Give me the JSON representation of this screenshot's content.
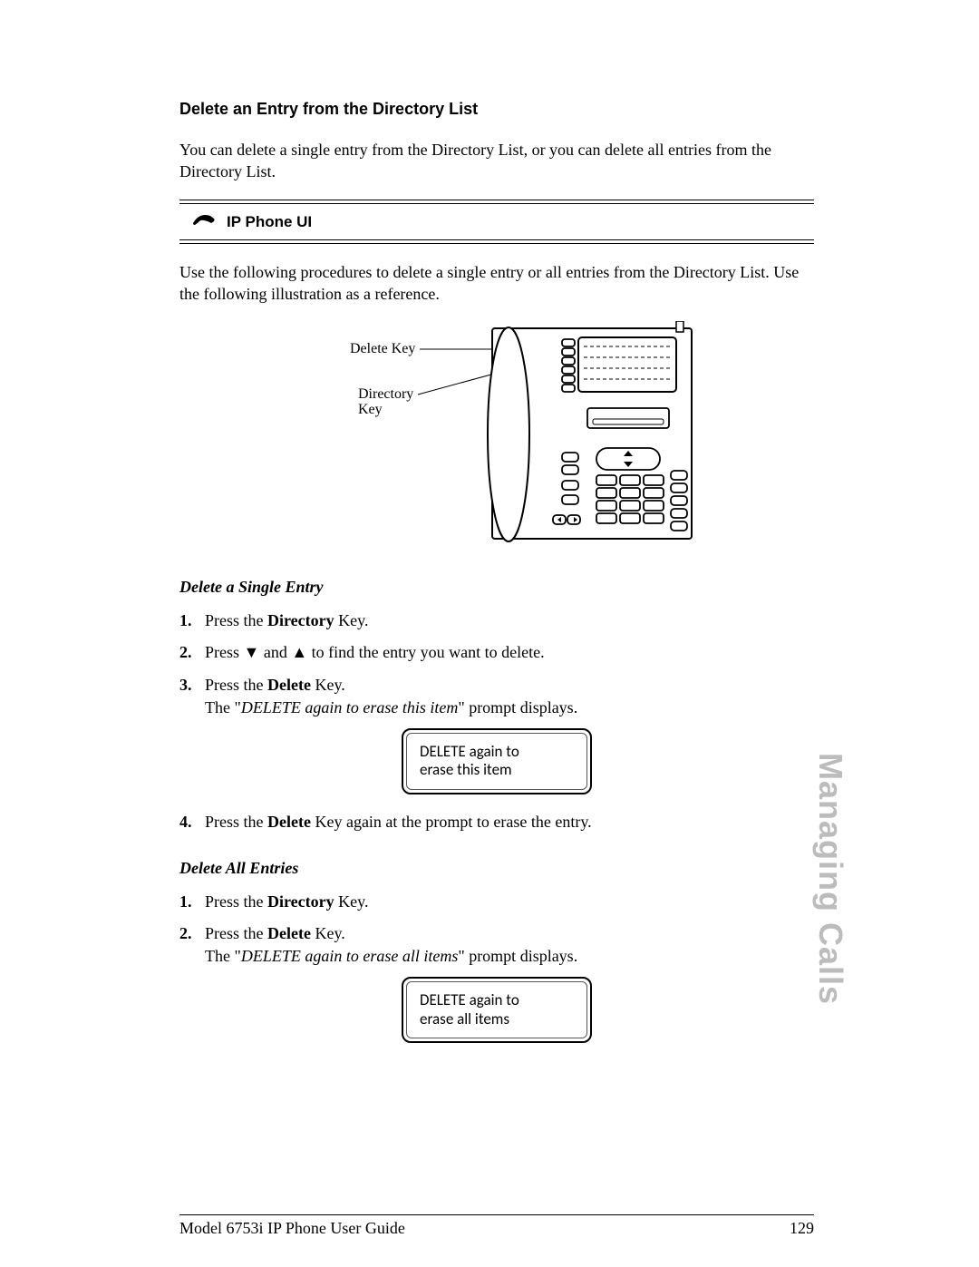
{
  "section": {
    "title": "Delete an Entry from the Directory List",
    "intro": "You can delete a single entry from the Directory List, or you can delete all entries from the Directory List."
  },
  "callout": {
    "label": "IP Phone UI"
  },
  "intro2": "Use the following procedures to delete a single entry or all entries from the Directory List. Use the following illustration as a reference.",
  "illustration": {
    "label_delete_key": "Delete Key",
    "label_directory_key_l1": "Directory",
    "label_directory_key_l2": "Key"
  },
  "single": {
    "heading": "Delete a Single Entry",
    "step1_pre": "Press the ",
    "step1_bold": "Directory",
    "step1_post": " Key.",
    "step2_pre": "Press ",
    "step2_mid": " and ",
    "step2_post": " to find the entry you want to delete.",
    "step3_line1_pre": "Press the ",
    "step3_line1_bold": "Delete",
    "step3_line1_post": " Key.",
    "step3_line2_pre": "The \"",
    "step3_line2_italic": "DELETE again to erase this item",
    "step3_line2_post": "\" prompt displays.",
    "prompt": "DELETE again to\nerase this item",
    "step4_pre": "Press the ",
    "step4_bold": "Delete",
    "step4_post": " Key again at the prompt to erase the entry."
  },
  "all": {
    "heading": "Delete All Entries",
    "step1_pre": "Press the ",
    "step1_bold": "Directory",
    "step1_post": " Key.",
    "step2_line1_pre": "Press the ",
    "step2_line1_bold": "Delete",
    "step2_line1_post": " Key.",
    "step2_line2_pre": "The \"",
    "step2_line2_italic": "DELETE again to erase all items",
    "step2_line2_post": "\" prompt displays.",
    "prompt": "DELETE again to\nerase all items"
  },
  "footer": {
    "left": "Model 6753i IP Phone User Guide",
    "right": "129"
  },
  "sidetab": "Managing Calls"
}
